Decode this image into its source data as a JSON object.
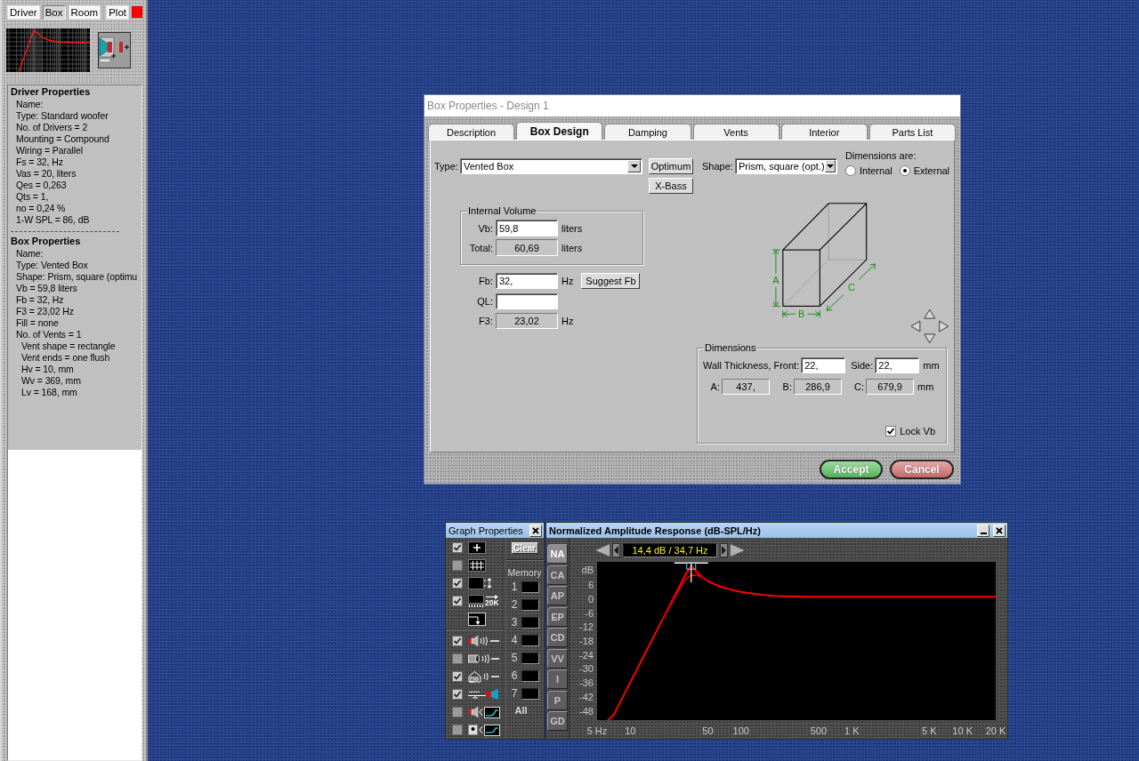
{
  "side_panel": {
    "tabs": [
      {
        "label": "Driver",
        "selected": false
      },
      {
        "label": "Box",
        "selected": true
      },
      {
        "label": "Room",
        "selected": false
      }
    ],
    "plot_button": "Plot",
    "sections": [
      {
        "heading": "Driver Properties",
        "lines": [
          {
            "text": "Name:"
          },
          {
            "text": "Type: Standard woofer"
          },
          {
            "text": "No. of Drivers = 2"
          },
          {
            "text": "Mounting = Compound"
          },
          {
            "text": "Wiring = Parallel"
          },
          {
            "text": "Fs = 32, Hz"
          },
          {
            "text": "Vas = 20, liters"
          },
          {
            "text": "Qes = 0,263"
          },
          {
            "text": "Qts = 1,"
          },
          {
            "text": "no = 0,24 %"
          },
          {
            "text": "1-W SPL = 86, dB"
          }
        ]
      },
      {
        "heading": "Box Properties",
        "lines": [
          {
            "text": "Name:"
          },
          {
            "text": "Type: Vented Box"
          },
          {
            "text": "Shape: Prism, square (optimu"
          },
          {
            "text": "Vb = 59,8 liters"
          },
          {
            "text": "Fb = 32, Hz"
          },
          {
            "text": "F3 = 23,02 Hz"
          },
          {
            "text": "Fill = none"
          },
          {
            "text": "No. of Vents = 1",
            "children": [
              {
                "text": "Vent shape = rectangle"
              },
              {
                "text": "Vent ends = one flush"
              },
              {
                "text": "Hv = 10, mm"
              },
              {
                "text": "Wv = 369, mm"
              },
              {
                "text": "Lv = 168, mm"
              }
            ]
          }
        ]
      }
    ]
  },
  "dialog": {
    "title": "Box Properties - Design 1",
    "tabs": [
      {
        "label": "Description",
        "selected": false
      },
      {
        "label": "Box Design",
        "selected": true
      },
      {
        "label": "Damping",
        "selected": false
      },
      {
        "label": "Vents",
        "selected": false
      },
      {
        "label": "Interior",
        "selected": false
      },
      {
        "label": "Parts List",
        "selected": false
      }
    ],
    "type": {
      "label": "Type:",
      "value": "Vented Box"
    },
    "side_buttons": [
      "Optimum",
      "X-Bass"
    ],
    "internal_volume": {
      "title": "Internal Volume",
      "fields": [
        {
          "label": "Vb:",
          "value": "59,8",
          "unit": "liters",
          "kind": "input"
        },
        {
          "label": "Total:",
          "value": "60,69",
          "unit": "liters",
          "kind": "readout"
        }
      ]
    },
    "tuning_fields": [
      {
        "label": "Fb:",
        "value": "32,",
        "unit": "Hz",
        "kind": "input",
        "action": "Suggest Fb"
      },
      {
        "label": "QL:",
        "kind": "input"
      },
      {
        "label": "F3:",
        "value": "23,02",
        "unit": "Hz",
        "kind": "readout"
      }
    ],
    "shape": {
      "label": "Shape:",
      "value": "Prism, square (opt.)"
    },
    "dimensions_are": {
      "label": "Dimensions are:",
      "options": [
        {
          "label": "Internal",
          "selected": false
        },
        {
          "label": "External",
          "selected": true
        }
      ]
    },
    "diagram_labels": [
      "A",
      "B",
      "C"
    ],
    "dimensions": {
      "title": "Dimensions",
      "front_label": "Wall Thickness, Front:",
      "front": "22,",
      "side_label": "Side:",
      "side": "22,",
      "unit": "mm",
      "sizes": [
        {
          "label": "A:",
          "value": "437,"
        },
        {
          "label": "B:",
          "value": "286,9"
        },
        {
          "label": "C:",
          "value": "679,9"
        }
      ],
      "sizes_unit": "mm",
      "lock": {
        "label": "Lock Vb",
        "checked": true
      }
    },
    "buttons": [
      {
        "label": "Accept",
        "kind": "accept"
      },
      {
        "label": "Cancel",
        "kind": "cancel"
      }
    ]
  },
  "graph_properties": {
    "title": "Graph Properties",
    "display_options": [
      {
        "kind": "crosshair",
        "checked": true
      },
      {
        "kind": "grid",
        "checked": false
      },
      {
        "kind": "scale",
        "checked": true
      },
      {
        "kind": "range",
        "checked": true,
        "label": "20K"
      }
    ],
    "source_options": [
      {
        "kind": "driver",
        "checked": true
      },
      {
        "kind": "port",
        "checked": false
      },
      {
        "kind": "room",
        "checked": true
      },
      {
        "kind": "circuit",
        "checked": true
      },
      {
        "kind": "excursion",
        "checked": false
      },
      {
        "kind": "velocity",
        "checked": false
      }
    ],
    "clear_button": "Clear",
    "memory_label": "Memory",
    "memory_slots": [
      "1",
      "2",
      "3",
      "4",
      "5",
      "6",
      "7"
    ],
    "all_label": "All"
  },
  "graph_window": {
    "title": "Normalized Amplitude Response (dB-SPL/Hz)",
    "view_tabs": [
      {
        "label": "NA",
        "selected": true
      },
      {
        "label": "CA",
        "selected": false
      },
      {
        "label": "AP",
        "selected": false
      },
      {
        "label": "EP",
        "selected": false
      },
      {
        "label": "CD",
        "selected": false
      },
      {
        "label": "VV",
        "selected": false
      },
      {
        "label": "I",
        "selected": false
      },
      {
        "label": "P",
        "selected": false
      },
      {
        "label": "GD",
        "selected": false
      }
    ],
    "readout": "14,4 dB / 34,7 Hz",
    "chart_data": {
      "type": "line",
      "ylabel": "dB",
      "categories": [
        "5 Hz",
        null,
        null,
        null,
        null,
        null,
        "10",
        null,
        null,
        null,
        null,
        null,
        null,
        null,
        null,
        null,
        null,
        null,
        null,
        null,
        "50",
        null,
        null,
        null,
        null,
        null,
        "100",
        null,
        null,
        null,
        null,
        null,
        null,
        null,
        null,
        null,
        null,
        null,
        null,
        null,
        "500",
        null,
        null,
        null,
        null,
        null,
        "1 K",
        null,
        null,
        null,
        null,
        null,
        null,
        null,
        null,
        null,
        null,
        null,
        null,
        null,
        "5 K",
        null,
        null,
        null,
        null,
        null,
        "10 K",
        null,
        null,
        null,
        null,
        null,
        "20 K"
      ],
      "series": [
        {
          "color": "#ff0000",
          "values": [
            null,
            null,
            -52,
            -49.8,
            -45.1,
            -40.5,
            -35.8,
            -31.2,
            -26.5,
            -21.9,
            -17.2,
            -12.6,
            -7.9,
            -3.3,
            1.4,
            6,
            10.7,
            14.4,
            11.6,
            9.5,
            7.8,
            6.6,
            5.7,
            4.8,
            4.2,
            3.6,
            3.1,
            2.7,
            2.4,
            2.1,
            1.8,
            1.6,
            1.4,
            1.3,
            1.2,
            1.2,
            1.1,
            1.1,
            1,
            1,
            1,
            1,
            1,
            1,
            1,
            1,
            1,
            1,
            1,
            1,
            1,
            1,
            1,
            1,
            1,
            1,
            1,
            1,
            1,
            1,
            1,
            1,
            1,
            1,
            1,
            1,
            1,
            1,
            1,
            1,
            1,
            1,
            1
          ]
        },
        {
          "color": "#c00000",
          "values": [
            null,
            null,
            null,
            null,
            null,
            null,
            null,
            null,
            null,
            null,
            null,
            null,
            -8.2,
            -3.9,
            0.5,
            4.6,
            8.5,
            10.4,
            10.3,
            9.3,
            7.8,
            null,
            null,
            null,
            null,
            null,
            null,
            null,
            null,
            null,
            null,
            null,
            null,
            null,
            null,
            null,
            null,
            null,
            null,
            null,
            null,
            null,
            null,
            null,
            null,
            null,
            null,
            null,
            null,
            null,
            null,
            null,
            null,
            null,
            null,
            null,
            null,
            null,
            null,
            null,
            null,
            null,
            null,
            null,
            null,
            null,
            null,
            null,
            null,
            null,
            null,
            null,
            null
          ]
        }
      ],
      "ylim": [
        -52,
        16
      ],
      "yticks": [
        6,
        0,
        -6,
        -12,
        -18,
        -24,
        -30,
        -36,
        -42,
        -48
      ]
    }
  }
}
